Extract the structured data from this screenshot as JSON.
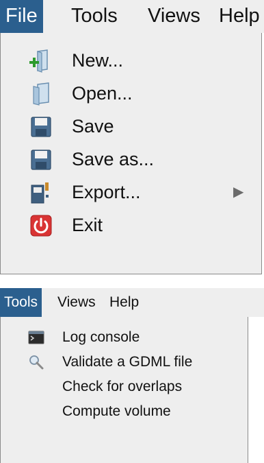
{
  "top_panel": {
    "menubar": {
      "items": [
        {
          "label": "File",
          "active": true
        },
        {
          "label": "Tools",
          "active": false
        },
        {
          "label": "Views",
          "active": false
        },
        {
          "label": "Help",
          "active": false
        }
      ]
    },
    "file_menu": {
      "items": [
        {
          "label": "New...",
          "icon": "new-document-icon"
        },
        {
          "label": "Open...",
          "icon": "open-document-icon"
        },
        {
          "label": "Save",
          "icon": "floppy-disk-icon"
        },
        {
          "label": "Save as...",
          "icon": "floppy-disk-icon"
        },
        {
          "label": "Export...",
          "icon": "export-icon",
          "submenu_arrow": "▶"
        },
        {
          "label": "Exit",
          "icon": "power-icon"
        }
      ]
    }
  },
  "bottom_panel": {
    "menubar": {
      "items": [
        {
          "label": "Tools",
          "active": true
        },
        {
          "label": "Views",
          "active": false
        },
        {
          "label": "Help",
          "active": false
        }
      ]
    },
    "tools_menu": {
      "items": [
        {
          "label": "Log console",
          "icon": "console-icon"
        },
        {
          "label": "Validate a GDML file",
          "icon": "magnifier-icon"
        },
        {
          "label": "Check for overlaps",
          "icon": ""
        },
        {
          "label": "Compute volume",
          "icon": ""
        }
      ]
    }
  },
  "colors": {
    "menu_bg": "#eeeeee",
    "selected_bg": "#2b5f8e",
    "selected_text": "#ffffff",
    "border": "#8a8a8a"
  }
}
